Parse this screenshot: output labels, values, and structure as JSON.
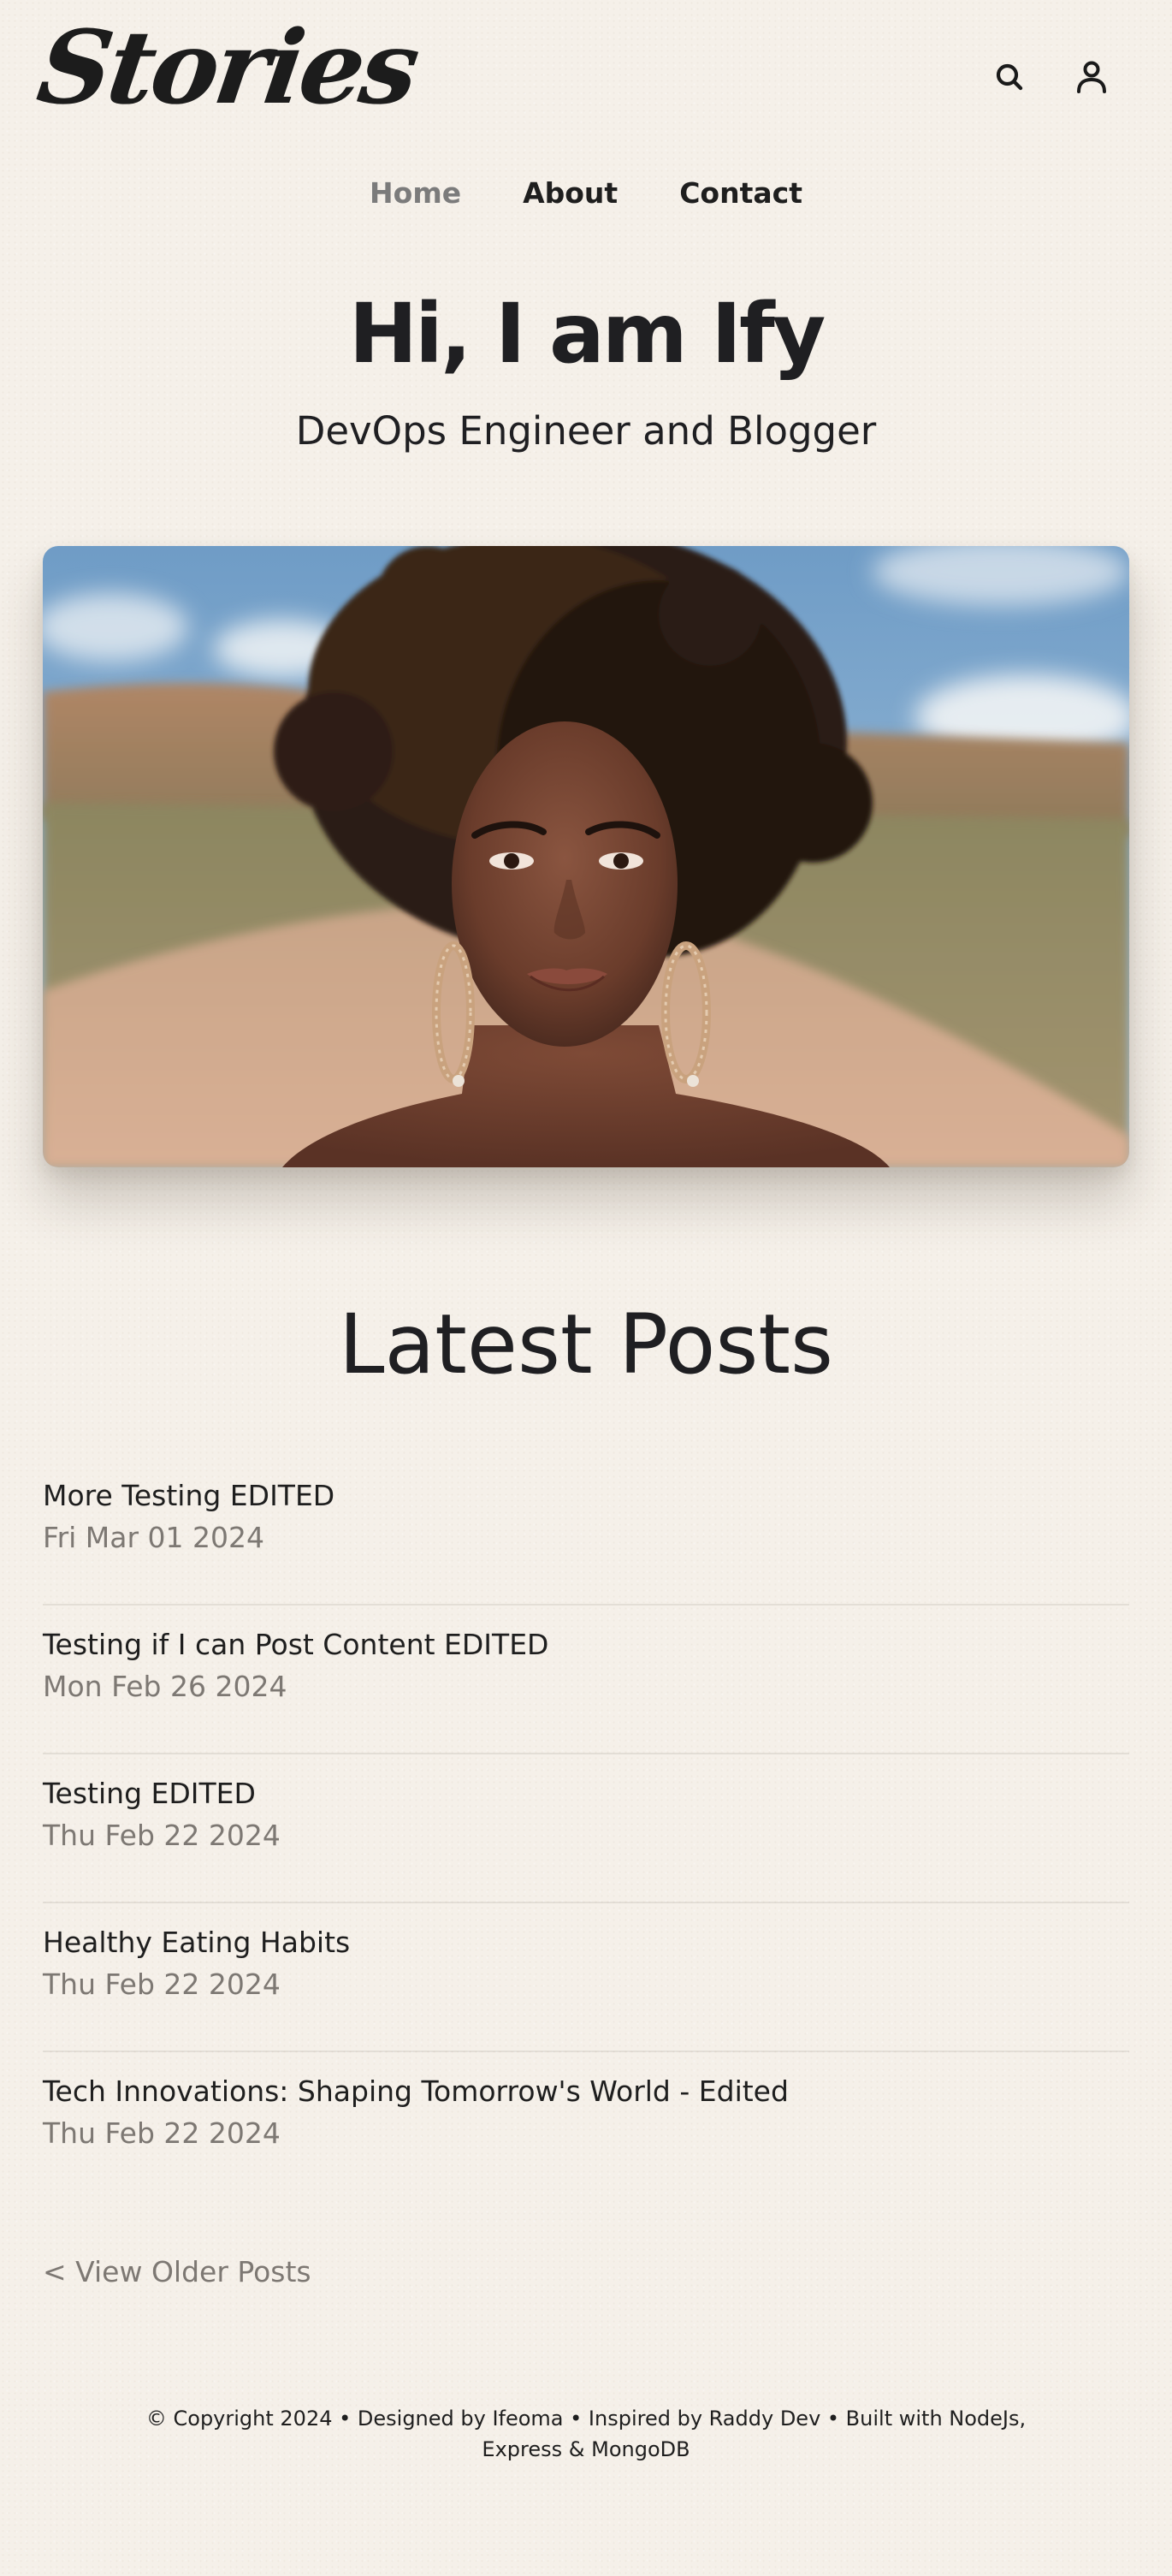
{
  "header": {
    "logo": "Stories",
    "icons": [
      "search-icon",
      "user-icon"
    ]
  },
  "nav": {
    "items": [
      {
        "label": "Home",
        "active": true
      },
      {
        "label": "About",
        "active": false
      },
      {
        "label": "Contact",
        "active": false
      }
    ]
  },
  "hero": {
    "title": "Hi, I am Ify",
    "subtitle": "DevOps Engineer and Blogger"
  },
  "posts": {
    "heading": "Latest Posts",
    "items": [
      {
        "title": "More Testing EDITED",
        "date": "Fri Mar 01 2024"
      },
      {
        "title": "Testing if I can Post Content EDITED",
        "date": "Mon Feb 26 2024"
      },
      {
        "title": "Testing EDITED",
        "date": "Thu Feb 22 2024"
      },
      {
        "title": "Healthy Eating Habits",
        "date": "Thu Feb 22 2024"
      },
      {
        "title": "Tech Innovations: Shaping Tomorrow's World - Edited",
        "date": "Thu Feb 22 2024"
      }
    ],
    "older_link": "< View Older Posts"
  },
  "footer": {
    "line1": "© Copyright 2024 • Designed by Ifeoma • Inspired by Raddy Dev • Built with NodeJs,",
    "line2": "Express & MongoDB"
  },
  "colors": {
    "background": "#f5f0e9",
    "text": "#1e1e1e",
    "muted": "#7d7873",
    "nav_active": "#7b7b7b"
  }
}
